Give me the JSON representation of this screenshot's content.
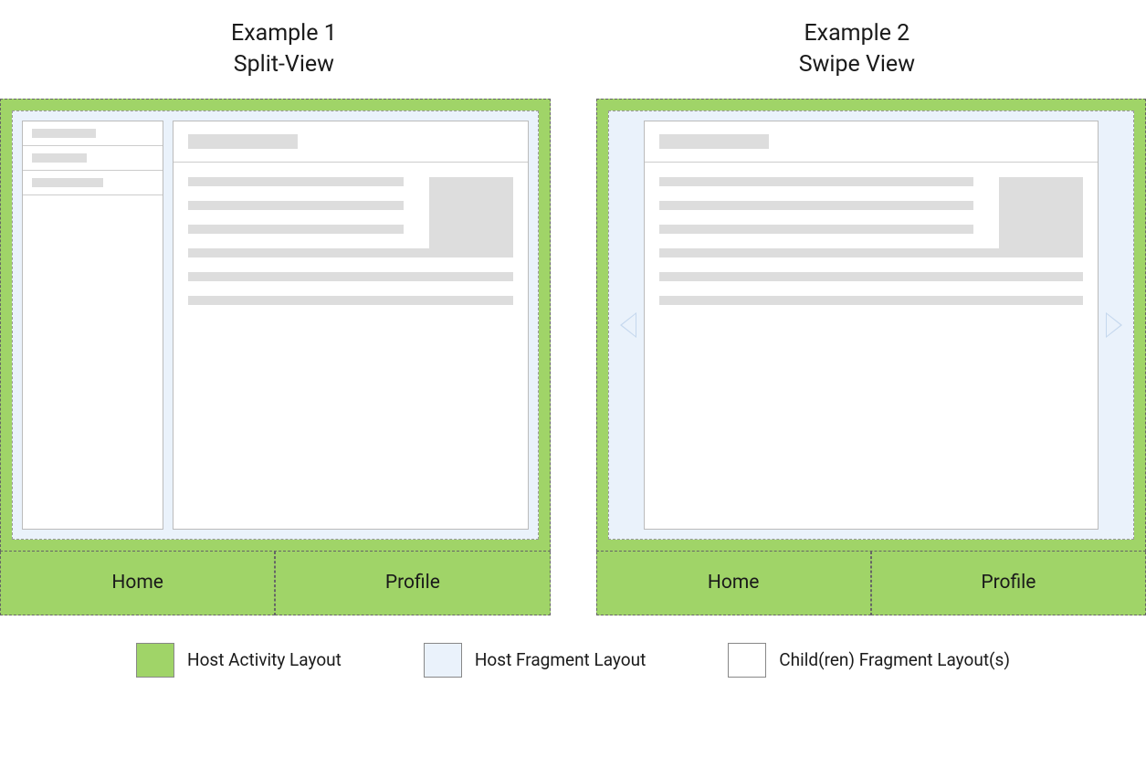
{
  "examples": [
    {
      "title_line1": "Example 1",
      "title_line2": "Split-View"
    },
    {
      "title_line1": "Example 2",
      "title_line2": "Swipe View"
    }
  ],
  "nav": {
    "home": "Home",
    "profile": "Profile"
  },
  "legend": {
    "host_activity": "Host Activity Layout",
    "host_fragment": "Host Fragment Layout",
    "child_fragment": "Child(ren) Fragment Layout(s)"
  }
}
